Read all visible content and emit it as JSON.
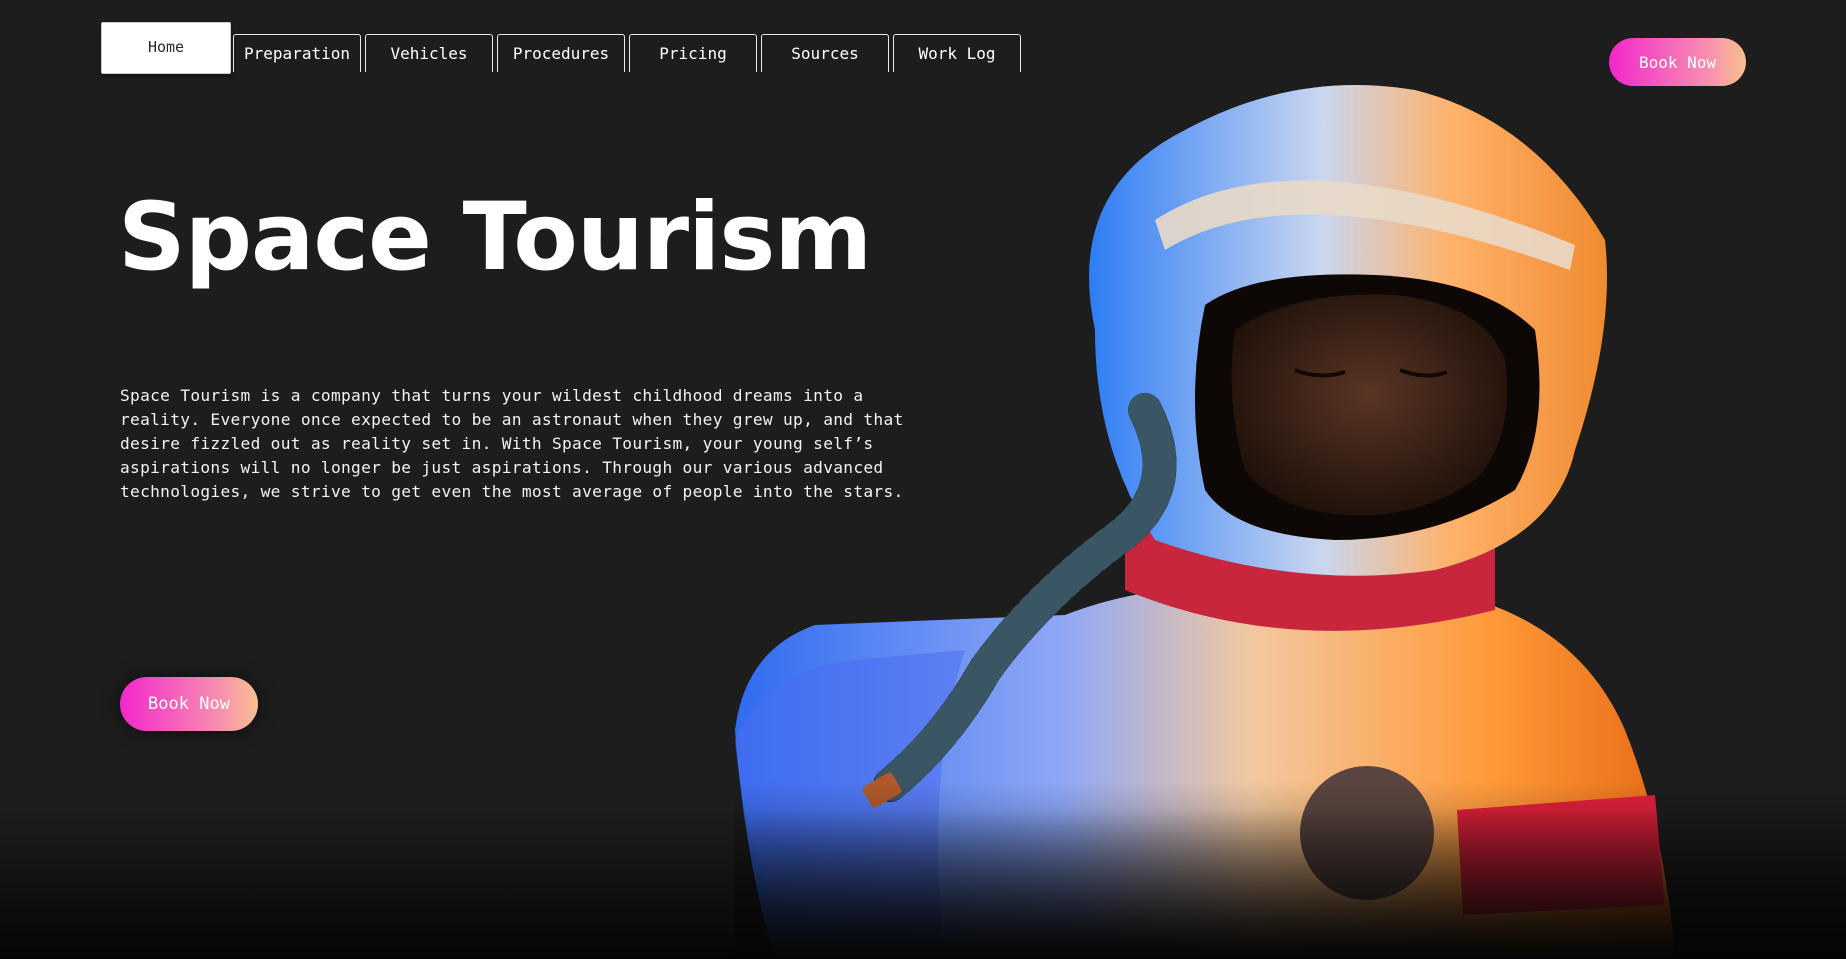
{
  "nav": {
    "tabs": [
      "Home",
      "Preparation",
      "Vehicles",
      "Procedures",
      "Pricing",
      "Sources",
      "Work Log"
    ],
    "active_tab": "Home"
  },
  "header": {
    "book_now_label": "Book Now"
  },
  "hero": {
    "title": "Space Tourism",
    "description": "Space Tourism is a company that turns your wildest childhood dreams into a reality. Everyone once expected to be an astronaut when they grew up, and that desire fizzled out as reality set in. With Space Tourism, your young self’s aspirations will no longer be just aspirations. Through our various advanced technologies, we strive to get even the most average of people into the stars.",
    "book_now_label": "Book Now",
    "image_alt": "astronaut"
  },
  "colors": {
    "background": "#1d1d1d",
    "button_gradient_start": "#f227cc",
    "button_gradient_end": "#f8c08f"
  }
}
